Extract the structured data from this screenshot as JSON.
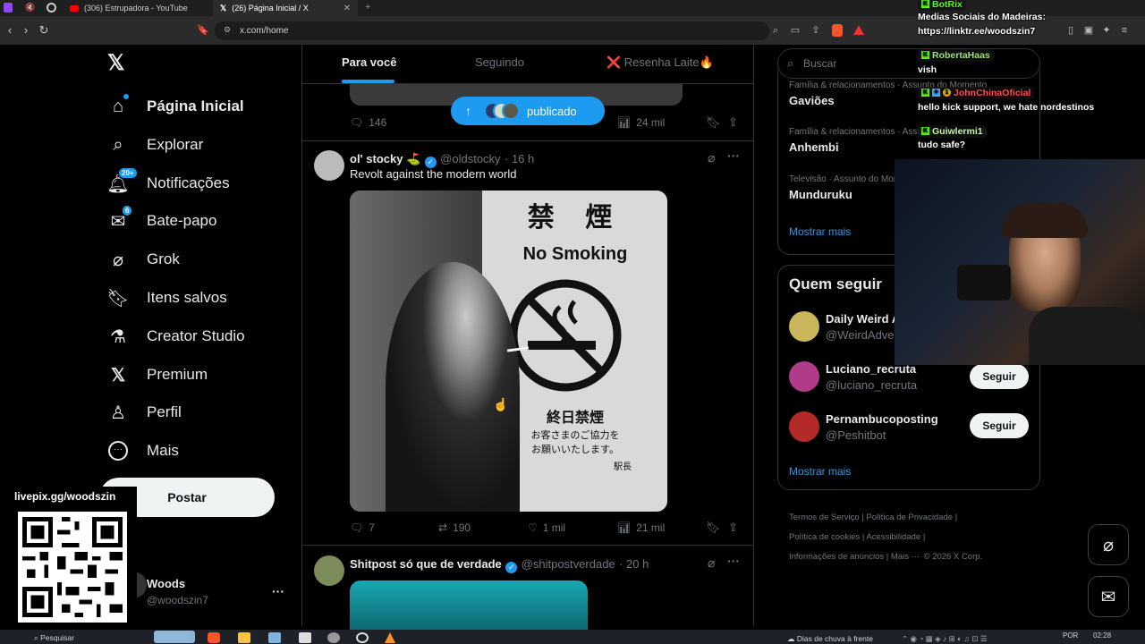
{
  "browser": {
    "tabs": [
      {
        "label": "(306) Estrupadora - YouTube"
      },
      {
        "label": "(26) Página Inicial / X"
      }
    ],
    "url": "x.com/home"
  },
  "nav": {
    "items": [
      {
        "label": "Página Inicial",
        "icon": "home-icon"
      },
      {
        "label": "Explorar",
        "icon": "search-icon"
      },
      {
        "label": "Notificações",
        "icon": "bell-icon",
        "badge": "20+"
      },
      {
        "label": "Bate-papo",
        "icon": "mail-icon",
        "badge": "6"
      },
      {
        "label": "Grok",
        "icon": "grok-icon"
      },
      {
        "label": "Itens salvos",
        "icon": "bookmark-icon"
      },
      {
        "label": "Creator Studio",
        "icon": "flask-icon"
      },
      {
        "label": "Premium",
        "icon": "x-logo-icon"
      },
      {
        "label": "Perfil",
        "icon": "person-icon"
      },
      {
        "label": "Mais",
        "icon": "more-icon"
      }
    ],
    "post_label": "Postar",
    "account": {
      "name": "Woods",
      "handle": "@woodszin7"
    }
  },
  "overlay": {
    "qr_label": "livepix.gg/woodszin",
    "chat": [
      {
        "user": "BotRix",
        "text": ""
      },
      {
        "user": "",
        "text": "Medias Sociais do Madeiras:"
      },
      {
        "user": "",
        "text": "https://linktr.ee/woodszin7"
      },
      {
        "user": "RobertaHaas",
        "text": ""
      },
      {
        "user": "",
        "text": "vish"
      },
      {
        "user": "JohnChinaOficial",
        "text": ""
      },
      {
        "user": "",
        "text": "hello kick support, we hate nordestinos"
      },
      {
        "user": "Guiwlermi1",
        "text": ""
      },
      {
        "user": "",
        "text": "tudo safe?"
      }
    ]
  },
  "feed": {
    "tabs": [
      "Para você",
      "Seguindo",
      "❌ Resenha Laite🔥"
    ],
    "published_pill": "publicado",
    "post0": {
      "replies": "146",
      "views": "24 mil"
    },
    "post1": {
      "name": "ol' stocky ⛳",
      "handle": "@oldstocky",
      "time": "· 16 h",
      "text": "Revolt against the modern world",
      "image_sign_kanji": "禁 煙",
      "image_sign_text": "No Smoking",
      "image_sign_kanji2": "終日禁煙",
      "image_sign_jp": "お客さまのご協力を",
      "image_sign_jp2": "お願いいたします。",
      "image_sign_station": "駅長",
      "replies": "7",
      "reposts": "190",
      "likes": "1 mil",
      "views": "21 mil"
    },
    "post2": {
      "name": "Shitpost só que de verdade",
      "handle": "@shitpostverdade",
      "time": "· 20 h"
    }
  },
  "sidebar": {
    "search_placeholder": "Buscar",
    "trends": [
      {
        "meta": "Família & relacionamentos · Assunto do Momento",
        "name": "Gaviões"
      },
      {
        "meta": "Família & relacionamentos · Assunto do Momento",
        "name": "Anhembi"
      },
      {
        "meta": "Televisão · Assunto do Momento",
        "name": "Munduruku"
      }
    ],
    "show_more": "Mostrar mais",
    "who_title": "Quem seguir",
    "who": [
      {
        "name": "Daily Weird A",
        "handle": "@WeirdAdver",
        "button": ""
      },
      {
        "name": "Luciano_recruta",
        "handle": "@luciano_recruta",
        "button": "Seguir"
      },
      {
        "name": "Pernambucoposting",
        "handle": "@Peshitbot",
        "button": "Seguir"
      }
    ],
    "show_more2": "Mostrar mais",
    "footer": [
      "Termos de Serviço",
      "Política de Privacidade",
      "Política de cookies",
      "Acessibilidade",
      "Informações de anúncios",
      "Mais ···",
      "© 2026 X Corp."
    ]
  },
  "taskbar": {
    "search": "Pesquisar",
    "weather": "Dias de chuva à frente",
    "lang": "POR",
    "time": "02:28"
  }
}
